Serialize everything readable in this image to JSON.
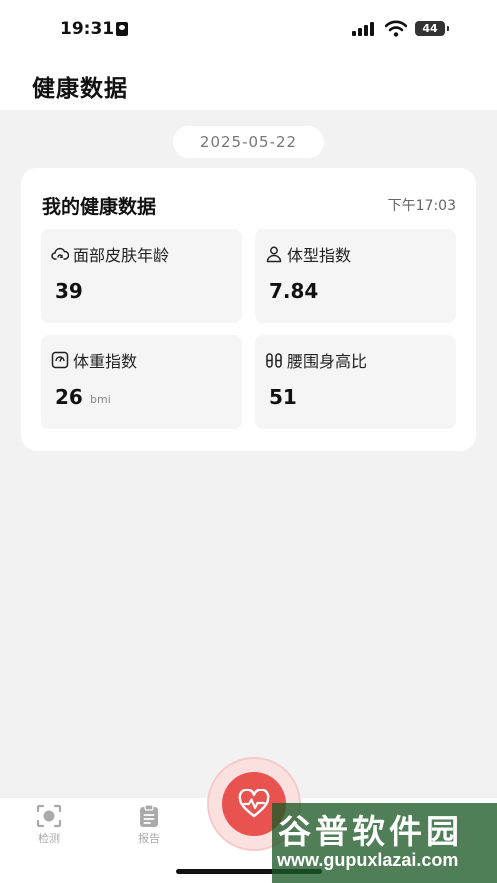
{
  "status_bar": {
    "time": "19:31",
    "battery": "44"
  },
  "header": {
    "title": "健康数据"
  },
  "date_pill": "2025-05-22",
  "card": {
    "title": "我的健康数据",
    "time": "下午17:03",
    "tiles": [
      {
        "icon": "cloud-refresh-icon",
        "label": "面部皮肤年龄",
        "value": "39",
        "unit": ""
      },
      {
        "icon": "person-icon",
        "label": "体型指数",
        "value": "7.84",
        "unit": ""
      },
      {
        "icon": "scale-icon",
        "label": "体重指数",
        "value": "26",
        "unit": "bmi"
      },
      {
        "icon": "waist-icon",
        "label": "腰围身高比",
        "value": "51",
        "unit": ""
      }
    ]
  },
  "tabbar": {
    "tabs": [
      {
        "icon": "scan-face-icon",
        "label": "检测"
      },
      {
        "icon": "clipboard-icon",
        "label": "报告"
      }
    ],
    "fab_icon": "heart-pulse-icon"
  },
  "watermark": {
    "title": "谷普软件园",
    "url": "www.gupuxlazai.com"
  },
  "colors": {
    "accent": "#e8524f",
    "background": "#f2f2f2",
    "card": "#ffffff",
    "tile": "#f5f5f5"
  }
}
